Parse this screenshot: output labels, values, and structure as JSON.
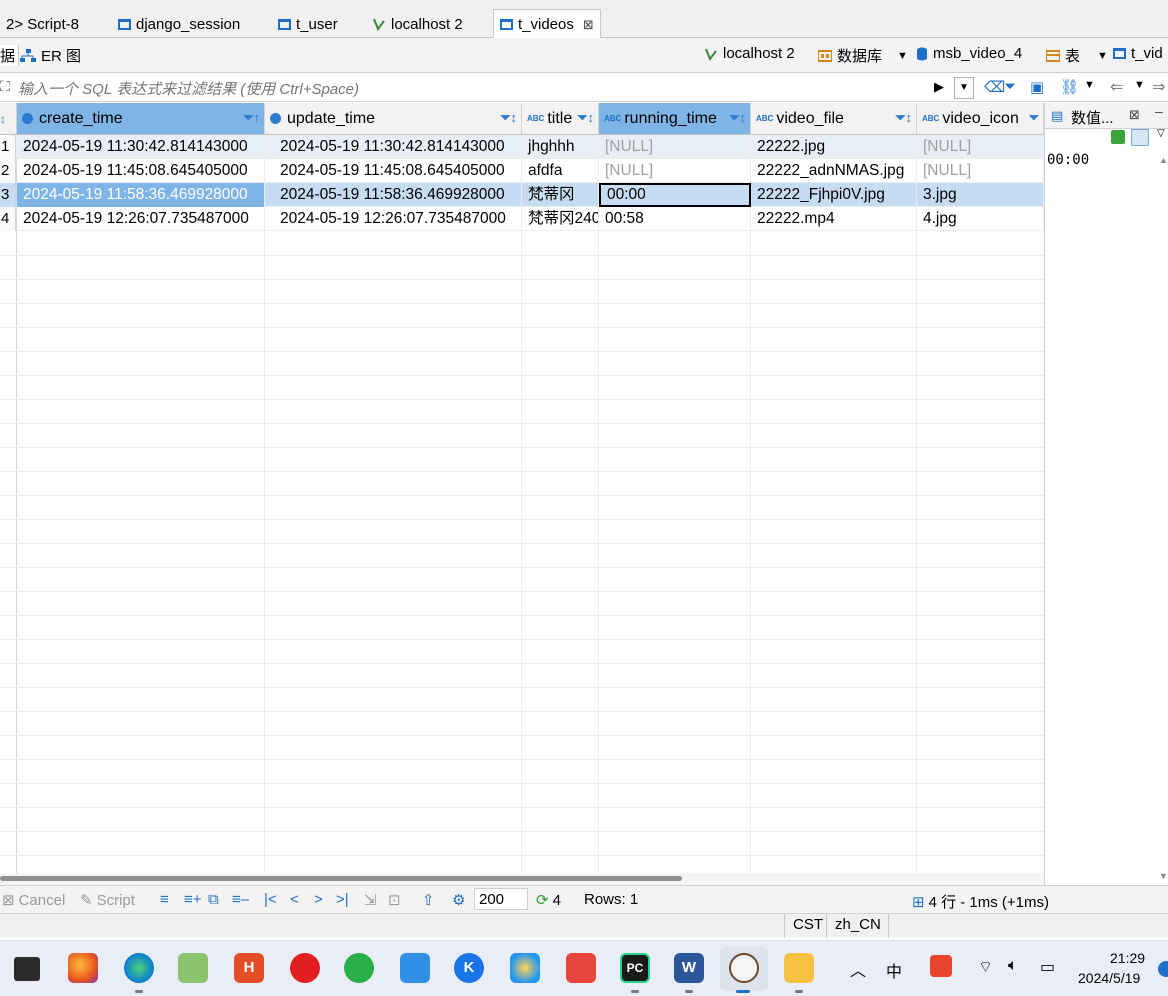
{
  "editor_tabs": [
    {
      "label": "2> Script-8",
      "icon": "script-icon"
    },
    {
      "label": "django_session",
      "icon": "table-icon"
    },
    {
      "label": "t_user",
      "icon": "table-icon"
    },
    {
      "label": "localhost 2",
      "icon": "connection-icon"
    },
    {
      "label": "t_videos",
      "icon": "table-icon",
      "active": true
    }
  ],
  "subbar": {
    "data_tab": "据",
    "er_tab": "ER 图",
    "connection": "localhost 2",
    "database_label": "数据库",
    "schema": "msb_video_4",
    "table_label": "表",
    "table_name": "t_vid"
  },
  "filter": {
    "placeholder": "输入一个 SQL 表达式来过滤结果 (使用 Ctrl+Space)"
  },
  "grid": {
    "columns": [
      {
        "name": "create_time",
        "type": "datetime"
      },
      {
        "name": "update_time",
        "type": "datetime"
      },
      {
        "name": "title",
        "type": "text"
      },
      {
        "name": "running_time",
        "type": "text"
      },
      {
        "name": "video_file",
        "type": "text"
      },
      {
        "name": "video_icon",
        "type": "text"
      }
    ],
    "rows": [
      {
        "num": "1",
        "create_time": "2024-05-19 11:30:42.814143000",
        "update_time": "2024-05-19 11:30:42.814143000",
        "title": "jhghhh",
        "running_time": "[NULL]",
        "video_file": "22222.jpg",
        "video_icon": "[NULL]"
      },
      {
        "num": "2",
        "create_time": "2024-05-19 11:45:08.645405000",
        "update_time": "2024-05-19 11:45:08.645405000",
        "title": "afdfa",
        "running_time": "[NULL]",
        "video_file": "22222_adnNMAS.jpg",
        "video_icon": "[NULL]"
      },
      {
        "num": "3",
        "create_time": "2024-05-19 11:58:36.469928000",
        "update_time": "2024-05-19 11:58:36.469928000",
        "title": "梵蒂冈",
        "running_time": "00:00",
        "video_file": "22222_Fjhpi0V.jpg",
        "video_icon": "3.jpg"
      },
      {
        "num": "4",
        "create_time": "2024-05-19 12:26:07.735487000",
        "update_time": "2024-05-19 12:26:07.735487000",
        "title": "梵蒂冈240",
        "running_time": "00:58",
        "video_file": "22222.mp4",
        "video_icon": "4.jpg"
      }
    ],
    "selected_row": 3,
    "selected_column": "running_time"
  },
  "value_panel": {
    "title": "数值...",
    "value": "00:00"
  },
  "bottombar": {
    "cancel": "Cancel",
    "script": "Script",
    "fetch_size": "200",
    "refresh_count": "4",
    "rows": "Rows: 1",
    "summary": "4 行 - 1ms (+1ms)"
  },
  "statusbar": {
    "timezone": "CST",
    "locale": "zh_CN"
  },
  "taskbar": {
    "time": "21:29",
    "date": "2024/5/19",
    "ime": "中",
    "apps": [
      "terminal-icon",
      "firefox-icon",
      "edge-icon",
      "notepad-plus-icon",
      "html-icon",
      "netease-music-icon",
      "wechat-icon",
      "notes-icon",
      "kugou-icon",
      "paint-icon",
      "xmind-icon",
      "pycharm-icon",
      "word-icon",
      "dbeaver-icon",
      "file-explorer-icon"
    ]
  },
  "colors": {
    "selected_row": "#c6dcf2",
    "selected_header": "#7fb4e6",
    "accent": "#1e6fc7"
  }
}
